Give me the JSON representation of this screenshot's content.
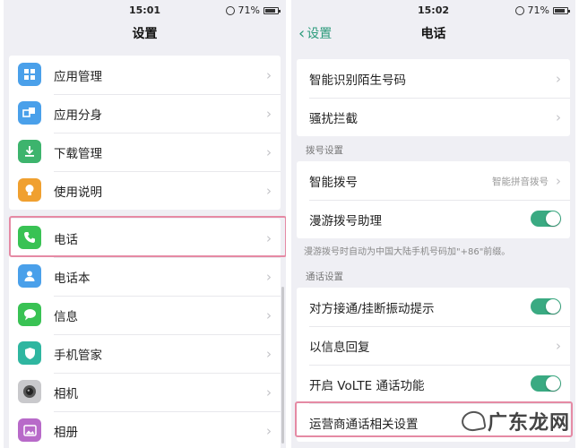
{
  "left": {
    "status": {
      "time": "15:01",
      "battery": "71%",
      "battery_level": 0.71
    },
    "title": "设置",
    "items": [
      {
        "label": "应用管理",
        "icon": "apps-grid-icon",
        "color": "#4aa0ea"
      },
      {
        "label": "应用分身",
        "icon": "app-clone-icon",
        "color": "#4aa0ea"
      },
      {
        "label": "下载管理",
        "icon": "download-icon",
        "color": "#3db46d"
      },
      {
        "label": "使用说明",
        "icon": "lightbulb-icon",
        "color": "#f0a030"
      },
      {
        "label": "电话",
        "icon": "phone-icon",
        "color": "#39c254"
      },
      {
        "label": "电话本",
        "icon": "contacts-icon",
        "color": "#4aa0ea"
      },
      {
        "label": "信息",
        "icon": "message-icon",
        "color": "#39c254"
      },
      {
        "label": "手机管家",
        "icon": "shield-icon",
        "color": "#2fb6a0"
      },
      {
        "label": "相机",
        "icon": "camera-icon",
        "color": "#777777"
      },
      {
        "label": "相册",
        "icon": "gallery-icon",
        "color": "#b86ac9"
      }
    ]
  },
  "right": {
    "status": {
      "time": "15:02",
      "battery": "71%",
      "battery_level": 0.71
    },
    "back_label": "设置",
    "title": "电话",
    "group1": [
      {
        "label": "智能识别陌生号码"
      },
      {
        "label": "骚扰拦截"
      }
    ],
    "section_dial": "拨号设置",
    "group2": [
      {
        "label": "智能拨号",
        "value": "智能拼音拨号"
      },
      {
        "label": "漫游拨号助理",
        "toggle": true
      }
    ],
    "roaming_note": "漫游拨号时自动为中国大陆手机号码加\"+86\"前缀。",
    "section_call": "通话设置",
    "group3": [
      {
        "label": "对方接通/挂断振动提示",
        "toggle": true
      },
      {
        "label": "以信息回复"
      },
      {
        "label": "开启 VoLTE 通话功能",
        "toggle": true
      },
      {
        "label": "运营商通话相关设置"
      }
    ]
  },
  "watermark": {
    "text": "广东龙网"
  },
  "colors": {
    "accent": "#3aaa82",
    "highlight": "#e58aa4",
    "background": "#efeff4"
  }
}
